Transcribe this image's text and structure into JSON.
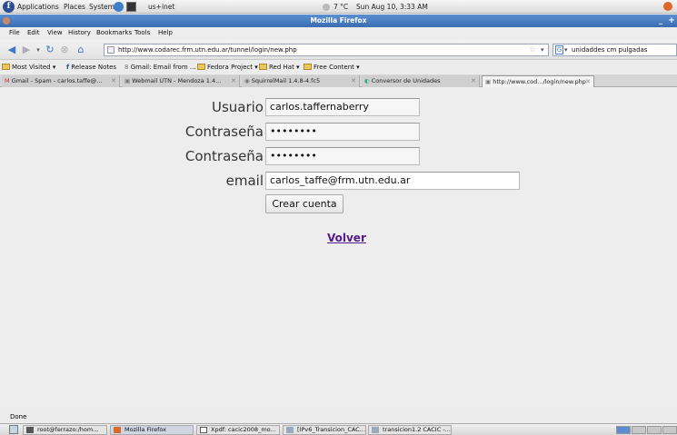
{
  "top_panel": {
    "menus": [
      "Applications",
      "Places",
      "System"
    ],
    "network": "us+inet",
    "weather": "7 °C",
    "datetime": "Sun Aug 10,  3:33 AM"
  },
  "window": {
    "title": "Mozilla Firefox"
  },
  "menubar": [
    "File",
    "Edit",
    "View",
    "History",
    "Bookmarks",
    "Tools",
    "Help"
  ],
  "navbar": {
    "url": "http://www.codarec.frm.utn.edu.ar/tunnel/login/new.php",
    "search_value": "unidaddes cm pulgadas"
  },
  "bookmarks": [
    "Most Visited",
    "Release Notes",
    "Gmail: Email from ...",
    "Fedora Project",
    "Red Hat",
    "Free Content"
  ],
  "tabs": [
    "Gmail - Spam - carlos.taffe@...",
    "Webmail UTN - Mendoza 1.4...",
    "SquirrelMail 1.4.8-4.fc5",
    "Conversor de Unidades",
    "http://www.cod.../login/new.php"
  ],
  "form": {
    "username_label": "Usuario",
    "username_value": "carlos.taffernaberry",
    "password_label": "Contraseña",
    "password_value": "••••••••",
    "confirm_label": "Contraseña",
    "confirm_value": "••••••••",
    "email_label": "email",
    "email_value": "carlos_taffe@frm.utn.edu.ar",
    "submit_label": "Crear cuenta",
    "back_link": "Volver"
  },
  "status": "Done",
  "taskbar": [
    "root@ferrazo:/hom...",
    "Mozilla Firefox",
    "Xpdf: cacic2008_mo...",
    "[IPv6_Transicion_CAC...",
    "transicion1.2 CACIC -..."
  ]
}
